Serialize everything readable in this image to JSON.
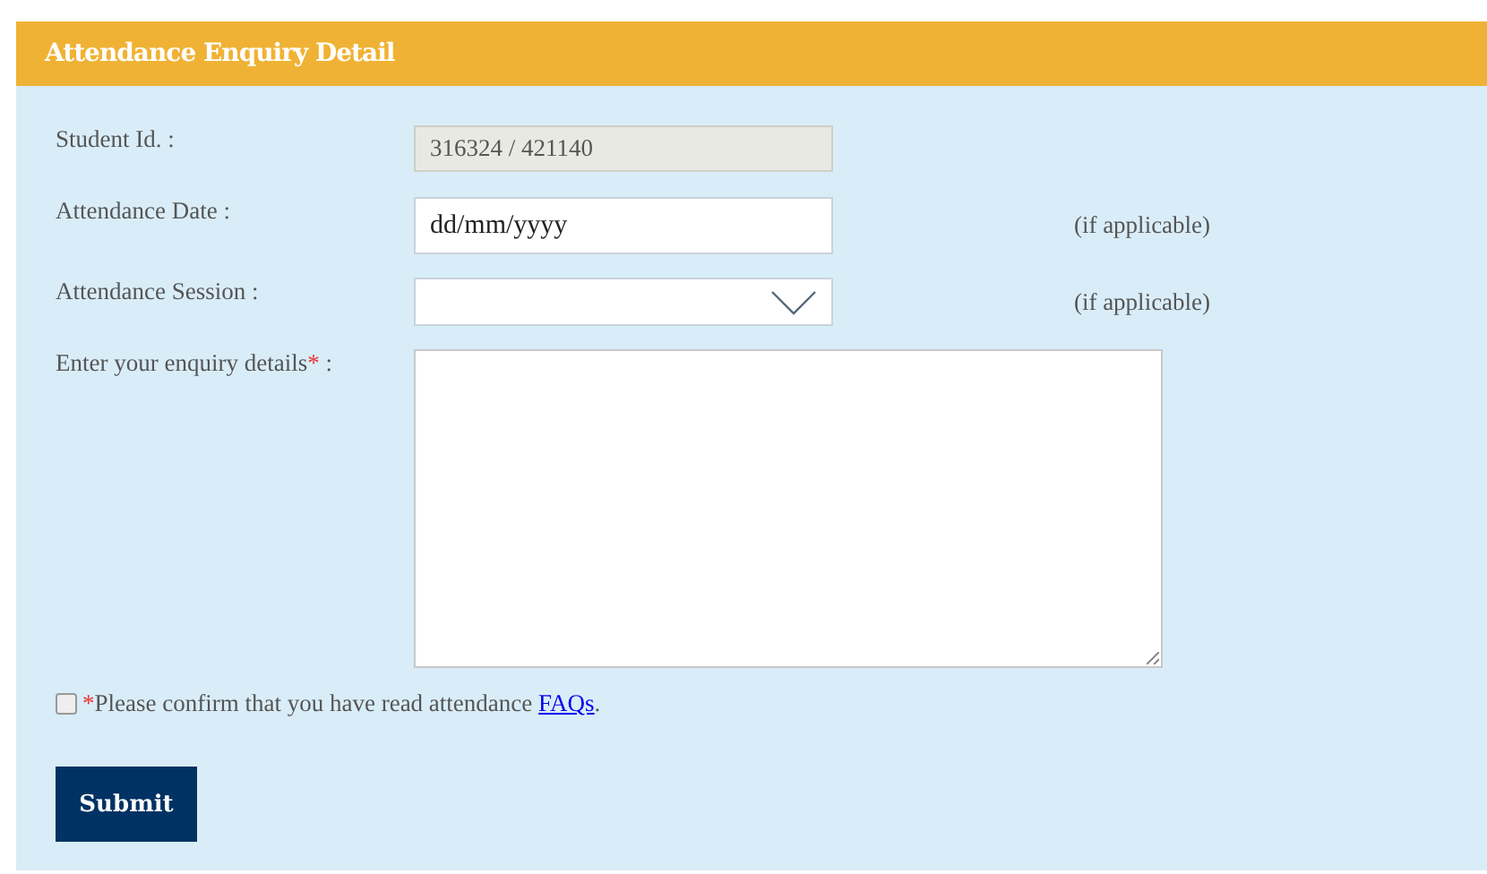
{
  "panel": {
    "title": "Attendance Enquiry Detail"
  },
  "fields": [
    {
      "kind": "readonly",
      "label": "Student Id. :",
      "value": "316324 / 421140"
    },
    {
      "kind": "text",
      "label": "Attendance Date :",
      "value": "dd/mm/yyyy",
      "note": "(if applicable)"
    },
    {
      "kind": "select",
      "label": "Attendance Session :",
      "note": "(if applicable)"
    },
    {
      "kind": "textarea",
      "label": "Enter your enquiry details",
      "required_mark": "*",
      "colon": ":"
    }
  ],
  "confirm": {
    "checked": false,
    "required_mark": "*",
    "text": "Please confirm that you have read attendance",
    "link": "FAQs",
    "end": "."
  },
  "submit": "Submit"
}
